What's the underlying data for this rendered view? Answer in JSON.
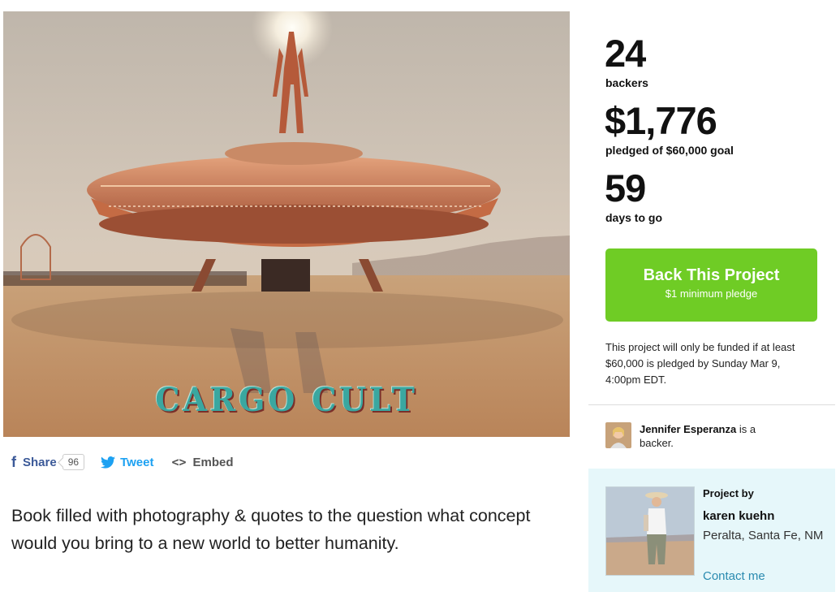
{
  "hero": {
    "caption": "CARGO CULT"
  },
  "share": {
    "share_label": "Share",
    "share_count": "96",
    "tweet_label": "Tweet",
    "embed_label": "Embed",
    "facebook_icon": "f",
    "embed_icon": "<>"
  },
  "description": "Book filled with photography & quotes to the question what concept would you bring to a new world to better humanity.",
  "stats": {
    "backers_count": "24",
    "backers_label": "backers",
    "pledged_amount": "$1,776",
    "pledged_label": "pledged of $60,000 goal",
    "days_count": "59",
    "days_label": "days to go"
  },
  "back_button": {
    "label": "Back This Project",
    "sublabel": "$1 minimum pledge"
  },
  "funding_note": "This project will only be funded if at least $60,000 is pledged by Sunday Mar 9, 4:00pm EDT.",
  "backer": {
    "name": "Jennifer Esperanza",
    "suffix": " is a backer."
  },
  "creator": {
    "heading": "Project by",
    "name": "karen kuehn",
    "location": "Peralta, Santa Fe, NM",
    "contact_label": "Contact me"
  },
  "colors": {
    "back_button": "#6fcc25",
    "facebook": "#3b5998",
    "twitter": "#1da1f2",
    "link": "#2a8bb0",
    "creator_bg": "#e6f7fa"
  }
}
